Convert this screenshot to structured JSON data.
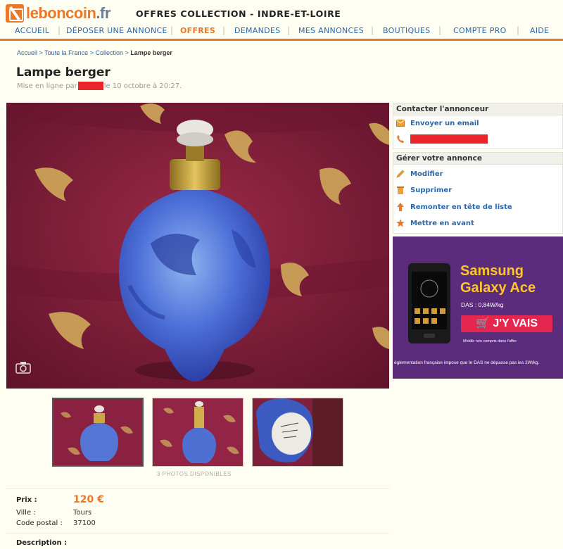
{
  "header": {
    "logo_text": "leboncoin",
    "logo_tld": ".fr",
    "section_title": "OFFRES COLLECTION - INDRE-ET-LOIRE"
  },
  "nav": {
    "items": [
      "ACCUEIL",
      "DÉPOSER UNE ANNONCE",
      "OFFRES",
      "DEMANDES",
      "MES ANNONCES",
      "BOUTIQUES",
      "COMPTE PRO",
      "AIDE"
    ],
    "active": "OFFRES",
    "active_color": "#e8782a",
    "link_color": "#2b66a9"
  },
  "breadcrumb": {
    "items": [
      "Accueil",
      "Toute la France",
      "Collection",
      "Lampe berger"
    ],
    "separator": ">"
  },
  "listing": {
    "title": "Lampe berger",
    "posted_prefix": "Mise en ligne par",
    "posted_suffix": "le 10 octobre à 20:27."
  },
  "photos": {
    "count_text": "3 PHOTOS DISPONIBLES"
  },
  "contact_panel": {
    "title": "Contacter l'annonceur",
    "email_label": "Envoyer un email"
  },
  "manage_panel": {
    "title": "Gérer votre annonce",
    "actions": [
      {
        "label": "Modifier",
        "icon": "pencil-icon"
      },
      {
        "label": "Supprimer",
        "icon": "trash-icon"
      },
      {
        "label": "Remonter en tête de liste",
        "icon": "arrow-up-icon"
      },
      {
        "label": "Mettre en avant",
        "icon": "star-icon"
      }
    ]
  },
  "ad": {
    "line1": "Samsung",
    "line2": "Galaxy Ace",
    "das": "DAS : 0,84W/kg",
    "cta": "J'Y VAIS",
    "small": "Mobile non compris dans l'offre",
    "fine_print": "églementation française impose que le DAS ne dépasse pas les 2W/kg."
  },
  "details": {
    "price_label": "Prix :",
    "price_value": "120 €",
    "city_label": "Ville :",
    "city_value": "Tours",
    "postal_label": "Code postal :",
    "postal_value": "37100",
    "description_label": "Description :"
  }
}
